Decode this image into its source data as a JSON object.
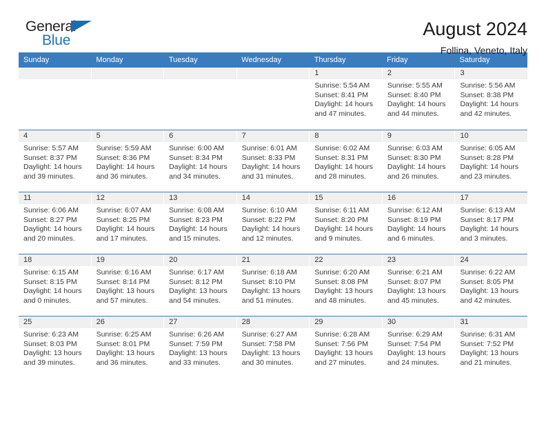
{
  "brand": {
    "name_top": "General",
    "name_bottom": "Blue",
    "accent_color": "#1b75bb",
    "flag_icon": "triangle-flag-icon"
  },
  "header": {
    "title": "August 2024",
    "subtitle": "Follina, Veneto, Italy"
  },
  "calendar": {
    "header_bg": "#3b7cbf",
    "daynum_bg": "#f0f0f0",
    "weekdays": [
      "Sunday",
      "Monday",
      "Tuesday",
      "Wednesday",
      "Thursday",
      "Friday",
      "Saturday"
    ],
    "weeks": [
      [
        {
          "day": "",
          "empty": true
        },
        {
          "day": "",
          "empty": true
        },
        {
          "day": "",
          "empty": true
        },
        {
          "day": "",
          "empty": true
        },
        {
          "day": "1",
          "sunrise": "Sunrise: 5:54 AM",
          "sunset": "Sunset: 8:41 PM",
          "daylight1": "Daylight: 14 hours",
          "daylight2": "and 47 minutes."
        },
        {
          "day": "2",
          "sunrise": "Sunrise: 5:55 AM",
          "sunset": "Sunset: 8:40 PM",
          "daylight1": "Daylight: 14 hours",
          "daylight2": "and 44 minutes."
        },
        {
          "day": "3",
          "sunrise": "Sunrise: 5:56 AM",
          "sunset": "Sunset: 8:38 PM",
          "daylight1": "Daylight: 14 hours",
          "daylight2": "and 42 minutes."
        }
      ],
      [
        {
          "day": "4",
          "sunrise": "Sunrise: 5:57 AM",
          "sunset": "Sunset: 8:37 PM",
          "daylight1": "Daylight: 14 hours",
          "daylight2": "and 39 minutes."
        },
        {
          "day": "5",
          "sunrise": "Sunrise: 5:59 AM",
          "sunset": "Sunset: 8:36 PM",
          "daylight1": "Daylight: 14 hours",
          "daylight2": "and 36 minutes."
        },
        {
          "day": "6",
          "sunrise": "Sunrise: 6:00 AM",
          "sunset": "Sunset: 8:34 PM",
          "daylight1": "Daylight: 14 hours",
          "daylight2": "and 34 minutes."
        },
        {
          "day": "7",
          "sunrise": "Sunrise: 6:01 AM",
          "sunset": "Sunset: 8:33 PM",
          "daylight1": "Daylight: 14 hours",
          "daylight2": "and 31 minutes."
        },
        {
          "day": "8",
          "sunrise": "Sunrise: 6:02 AM",
          "sunset": "Sunset: 8:31 PM",
          "daylight1": "Daylight: 14 hours",
          "daylight2": "and 28 minutes."
        },
        {
          "day": "9",
          "sunrise": "Sunrise: 6:03 AM",
          "sunset": "Sunset: 8:30 PM",
          "daylight1": "Daylight: 14 hours",
          "daylight2": "and 26 minutes."
        },
        {
          "day": "10",
          "sunrise": "Sunrise: 6:05 AM",
          "sunset": "Sunset: 8:28 PM",
          "daylight1": "Daylight: 14 hours",
          "daylight2": "and 23 minutes."
        }
      ],
      [
        {
          "day": "11",
          "sunrise": "Sunrise: 6:06 AM",
          "sunset": "Sunset: 8:27 PM",
          "daylight1": "Daylight: 14 hours",
          "daylight2": "and 20 minutes."
        },
        {
          "day": "12",
          "sunrise": "Sunrise: 6:07 AM",
          "sunset": "Sunset: 8:25 PM",
          "daylight1": "Daylight: 14 hours",
          "daylight2": "and 17 minutes."
        },
        {
          "day": "13",
          "sunrise": "Sunrise: 6:08 AM",
          "sunset": "Sunset: 8:23 PM",
          "daylight1": "Daylight: 14 hours",
          "daylight2": "and 15 minutes."
        },
        {
          "day": "14",
          "sunrise": "Sunrise: 6:10 AM",
          "sunset": "Sunset: 8:22 PM",
          "daylight1": "Daylight: 14 hours",
          "daylight2": "and 12 minutes."
        },
        {
          "day": "15",
          "sunrise": "Sunrise: 6:11 AM",
          "sunset": "Sunset: 8:20 PM",
          "daylight1": "Daylight: 14 hours",
          "daylight2": "and 9 minutes."
        },
        {
          "day": "16",
          "sunrise": "Sunrise: 6:12 AM",
          "sunset": "Sunset: 8:19 PM",
          "daylight1": "Daylight: 14 hours",
          "daylight2": "and 6 minutes."
        },
        {
          "day": "17",
          "sunrise": "Sunrise: 6:13 AM",
          "sunset": "Sunset: 8:17 PM",
          "daylight1": "Daylight: 14 hours",
          "daylight2": "and 3 minutes."
        }
      ],
      [
        {
          "day": "18",
          "sunrise": "Sunrise: 6:15 AM",
          "sunset": "Sunset: 8:15 PM",
          "daylight1": "Daylight: 14 hours",
          "daylight2": "and 0 minutes."
        },
        {
          "day": "19",
          "sunrise": "Sunrise: 6:16 AM",
          "sunset": "Sunset: 8:14 PM",
          "daylight1": "Daylight: 13 hours",
          "daylight2": "and 57 minutes."
        },
        {
          "day": "20",
          "sunrise": "Sunrise: 6:17 AM",
          "sunset": "Sunset: 8:12 PM",
          "daylight1": "Daylight: 13 hours",
          "daylight2": "and 54 minutes."
        },
        {
          "day": "21",
          "sunrise": "Sunrise: 6:18 AM",
          "sunset": "Sunset: 8:10 PM",
          "daylight1": "Daylight: 13 hours",
          "daylight2": "and 51 minutes."
        },
        {
          "day": "22",
          "sunrise": "Sunrise: 6:20 AM",
          "sunset": "Sunset: 8:08 PM",
          "daylight1": "Daylight: 13 hours",
          "daylight2": "and 48 minutes."
        },
        {
          "day": "23",
          "sunrise": "Sunrise: 6:21 AM",
          "sunset": "Sunset: 8:07 PM",
          "daylight1": "Daylight: 13 hours",
          "daylight2": "and 45 minutes."
        },
        {
          "day": "24",
          "sunrise": "Sunrise: 6:22 AM",
          "sunset": "Sunset: 8:05 PM",
          "daylight1": "Daylight: 13 hours",
          "daylight2": "and 42 minutes."
        }
      ],
      [
        {
          "day": "25",
          "sunrise": "Sunrise: 6:23 AM",
          "sunset": "Sunset: 8:03 PM",
          "daylight1": "Daylight: 13 hours",
          "daylight2": "and 39 minutes."
        },
        {
          "day": "26",
          "sunrise": "Sunrise: 6:25 AM",
          "sunset": "Sunset: 8:01 PM",
          "daylight1": "Daylight: 13 hours",
          "daylight2": "and 36 minutes."
        },
        {
          "day": "27",
          "sunrise": "Sunrise: 6:26 AM",
          "sunset": "Sunset: 7:59 PM",
          "daylight1": "Daylight: 13 hours",
          "daylight2": "and 33 minutes."
        },
        {
          "day": "28",
          "sunrise": "Sunrise: 6:27 AM",
          "sunset": "Sunset: 7:58 PM",
          "daylight1": "Daylight: 13 hours",
          "daylight2": "and 30 minutes."
        },
        {
          "day": "29",
          "sunrise": "Sunrise: 6:28 AM",
          "sunset": "Sunset: 7:56 PM",
          "daylight1": "Daylight: 13 hours",
          "daylight2": "and 27 minutes."
        },
        {
          "day": "30",
          "sunrise": "Sunrise: 6:29 AM",
          "sunset": "Sunset: 7:54 PM",
          "daylight1": "Daylight: 13 hours",
          "daylight2": "and 24 minutes."
        },
        {
          "day": "31",
          "sunrise": "Sunrise: 6:31 AM",
          "sunset": "Sunset: 7:52 PM",
          "daylight1": "Daylight: 13 hours",
          "daylight2": "and 21 minutes."
        }
      ]
    ]
  }
}
